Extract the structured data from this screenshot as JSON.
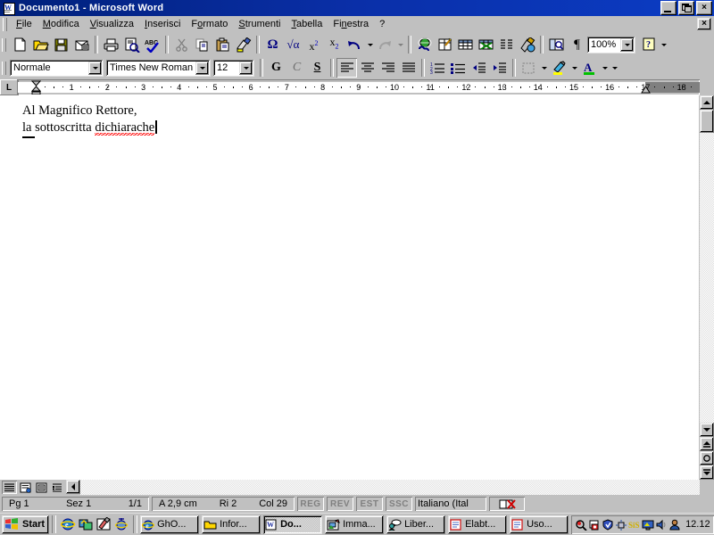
{
  "window": {
    "title": "Documento1 - Microsoft Word",
    "icon": "word-document-icon",
    "minimize_label": "_",
    "restore_label": "restore",
    "close_label": "×",
    "document_close_label": "×"
  },
  "menubar": {
    "items": [
      {
        "label": "File",
        "accel": "F"
      },
      {
        "label": "Modifica",
        "accel": "M"
      },
      {
        "label": "Visualizza",
        "accel": "V"
      },
      {
        "label": "Inserisci",
        "accel": "I"
      },
      {
        "label": "Formato",
        "accel": "o"
      },
      {
        "label": "Strumenti",
        "accel": "S"
      },
      {
        "label": "Tabella",
        "accel": "T"
      },
      {
        "label": "Finestra",
        "accel": "n"
      },
      {
        "label": "?",
        "accel": ""
      }
    ]
  },
  "standard_toolbar": {
    "buttons": [
      {
        "name": "new-document-button",
        "tooltip": "Nuovo"
      },
      {
        "name": "open-button",
        "tooltip": "Apri"
      },
      {
        "name": "save-button",
        "tooltip": "Salva"
      },
      {
        "name": "email-button",
        "tooltip": "Posta elettronica"
      },
      {
        "name": "print-button",
        "tooltip": "Stampa"
      },
      {
        "name": "print-preview-button",
        "tooltip": "Anteprima di stampa"
      },
      {
        "name": "spelling-check-button",
        "tooltip": "Controllo ortografia"
      },
      {
        "name": "cut-button",
        "tooltip": "Taglia"
      },
      {
        "name": "copy-button",
        "tooltip": "Copia"
      },
      {
        "name": "paste-button",
        "tooltip": "Incolla"
      },
      {
        "name": "format-painter-button",
        "tooltip": "Copia formato"
      },
      {
        "name": "insert-symbol-button",
        "tooltip": "Inserisci simbolo"
      },
      {
        "name": "insert-equation-button",
        "tooltip": "Editor equazioni"
      },
      {
        "name": "superscript-button",
        "tooltip": "Apice"
      },
      {
        "name": "subscript-button",
        "tooltip": "Pedice"
      },
      {
        "name": "undo-button",
        "tooltip": "Annulla"
      },
      {
        "name": "redo-button",
        "tooltip": "Ripristina"
      },
      {
        "name": "insert-hyperlink-button",
        "tooltip": "Inserisci collegamento ipertestuale"
      },
      {
        "name": "draw-table-button",
        "tooltip": "Disegna tabella"
      },
      {
        "name": "insert-table-button",
        "tooltip": "Inserisci tabella"
      },
      {
        "name": "insert-excel-sheet-button",
        "tooltip": "Inserisci foglio di lavoro"
      },
      {
        "name": "columns-button",
        "tooltip": "Colonne"
      },
      {
        "name": "drawing-button",
        "tooltip": "Disegno"
      },
      {
        "name": "document-map-button",
        "tooltip": "Mappa documento"
      },
      {
        "name": "show-formatting-marks-button",
        "tooltip": "Mostra/Nascondi"
      },
      {
        "name": "help-button",
        "tooltip": "Guida"
      }
    ],
    "superscript_label": "x",
    "superscript_exp": "2",
    "subscript_label": "x",
    "subscript_exp": "2",
    "symbol_label": "Ω",
    "equation_label": "√α",
    "paragraph_mark": "¶",
    "help_mark": "?",
    "zoom_value": "100%"
  },
  "formatting_toolbar": {
    "style": {
      "value": "Normale",
      "placeholder": "Stile"
    },
    "font": {
      "value": "Times New Roman",
      "placeholder": "Tipo di carattere"
    },
    "size": {
      "value": "12",
      "placeholder": "Dimensione"
    },
    "bold_label": "G",
    "italic_label": "C",
    "underline_label": "S",
    "font_color_label": "A",
    "buttons": [
      {
        "name": "bold-button",
        "tooltip": "Grassetto"
      },
      {
        "name": "italic-button",
        "tooltip": "Corsivo"
      },
      {
        "name": "underline-button",
        "tooltip": "Sottolineato"
      },
      {
        "name": "align-left-button",
        "tooltip": "Allinea a sinistra",
        "active": true
      },
      {
        "name": "align-center-button",
        "tooltip": "Centra"
      },
      {
        "name": "align-right-button",
        "tooltip": "Allinea a destra"
      },
      {
        "name": "justify-button",
        "tooltip": "Giustifica"
      },
      {
        "name": "numbered-list-button",
        "tooltip": "Elenco numerato"
      },
      {
        "name": "bulleted-list-button",
        "tooltip": "Elenco puntato"
      },
      {
        "name": "decrease-indent-button",
        "tooltip": "Riduci rientro"
      },
      {
        "name": "increase-indent-button",
        "tooltip": "Aumenta rientro"
      },
      {
        "name": "borders-button",
        "tooltip": "Bordi"
      },
      {
        "name": "highlight-button",
        "tooltip": "Evidenziatore"
      },
      {
        "name": "font-color-button",
        "tooltip": "Colore carattere"
      }
    ],
    "highlight_color": "#ffff00",
    "font_color": "#00c000"
  },
  "ruler": {
    "tab_selector_label": "L",
    "numbers": [
      "1",
      "2",
      "3",
      "4",
      "5",
      "6",
      "7",
      "8",
      "9",
      "10",
      "11",
      "12",
      "13",
      "14",
      "15",
      "16",
      "17",
      "18"
    ],
    "unit": "cm",
    "left_indent_cm": 0,
    "right_indent_cm": 17
  },
  "document": {
    "line1": "Al Magnifico Rettore,",
    "line2_prefix": "la sottoscritta ",
    "line2_misspelled": "dichiarache",
    "spellcheck_color": "#ff0000"
  },
  "statusbar": {
    "page": "Pg  1",
    "section": "Sez  1",
    "pages": "1/1",
    "at": "A  2,9 cm",
    "line": "Ri  2",
    "column": "Col  29",
    "modes": [
      "REG",
      "REV",
      "EST",
      "SSC"
    ],
    "language": "Italiano (Ital",
    "spellcheck_icon": "spellcheck-status-icon"
  },
  "view_buttons": [
    {
      "name": "normal-view-button",
      "label": "Normale",
      "active": true
    },
    {
      "name": "web-layout-view-button",
      "label": "Layout Web"
    },
    {
      "name": "print-layout-view-button",
      "label": "Layout di stampa"
    },
    {
      "name": "outline-view-button",
      "label": "Struttura"
    }
  ],
  "scrollbar": {
    "previous_page_label": "Pagina precedente",
    "select_browse_object_label": "Seleziona oggetto da sfogliare",
    "next_page_label": "Pagina successiva"
  },
  "taskbar": {
    "start_label": "Start",
    "quick_launch": [
      {
        "name": "internet-explorer-icon"
      },
      {
        "name": "show-desktop-icon"
      },
      {
        "name": "outlook-express-icon"
      },
      {
        "name": "view-channels-icon"
      }
    ],
    "tasks": [
      {
        "label": "GhO...",
        "icon": "internet-explorer-icon",
        "active": false
      },
      {
        "label": "Infor...",
        "icon": "folder-icon",
        "active": false
      },
      {
        "label": "Do...",
        "icon": "word-icon",
        "active": true
      },
      {
        "label": "Imma...",
        "icon": "imaging-icon",
        "active": false
      },
      {
        "label": "Liber...",
        "icon": "chat-icon",
        "active": false
      },
      {
        "label": "Elabt...",
        "icon": "wordpad-icon",
        "active": false
      },
      {
        "label": "Uso...",
        "icon": "wordpad-icon",
        "active": false
      }
    ],
    "tray_icons": [
      {
        "name": "find-fast-icon"
      },
      {
        "name": "antivirus-shield-icon"
      },
      {
        "name": "network-icon"
      },
      {
        "name": "sis-display-icon"
      },
      {
        "name": "display-properties-icon"
      },
      {
        "name": "volume-icon"
      },
      {
        "name": "user-icon"
      }
    ],
    "clock": "12.12"
  }
}
